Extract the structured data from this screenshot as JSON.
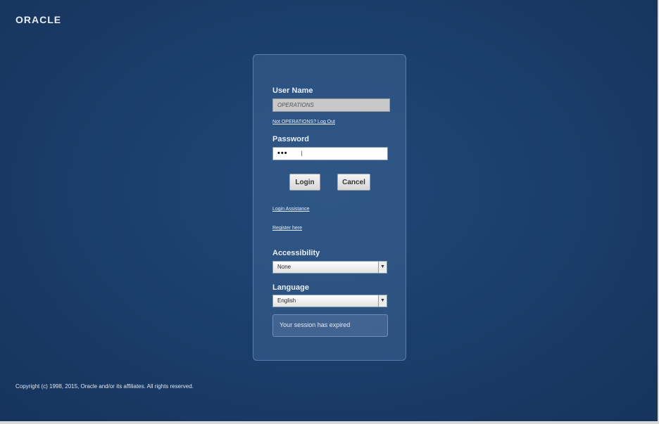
{
  "brand": {
    "logo_text": "ORACLE"
  },
  "login_form": {
    "username_label": "User Name",
    "username_value": "OPERATIONS",
    "not_user_link": "Not OPERATIONS? Log Out",
    "password_label": "Password",
    "password_value": "•••",
    "login_button": "Login",
    "cancel_button": "Cancel",
    "login_assistance_link": "Login Assistance",
    "register_link": "Register here",
    "accessibility_label": "Accessibility",
    "accessibility_value": "None",
    "language_label": "Language",
    "language_value": "English",
    "status_message": "Your session has expired"
  },
  "footer": {
    "copyright": "Copyright (c) 1998, 2015, Oracle and/or its affiliates. All rights reserved."
  },
  "colors": {
    "background": "#1b3c66",
    "panel": "#3c6292"
  }
}
